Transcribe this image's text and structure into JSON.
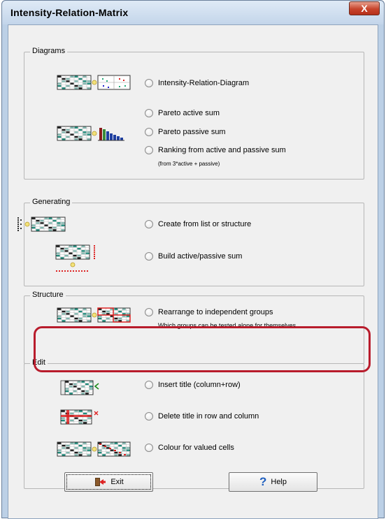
{
  "window": {
    "title": "Intensity-Relation-Matrix",
    "close_label": "X"
  },
  "groups": {
    "diagrams": {
      "label": "Diagrams",
      "options": {
        "intensity": "Intensity-Relation-Diagram",
        "pareto_active": "Pareto active sum",
        "pareto_passive": "Pareto passive sum",
        "ranking": "Ranking from active and passive sum",
        "ranking_note": "(from 3*active + passive)"
      }
    },
    "generating": {
      "label": "Generating",
      "options": {
        "create": "Create from list or structure",
        "build": "Build active/passive sum"
      }
    },
    "structure": {
      "label": "Structure",
      "options": {
        "rearrange": "Rearrange to independent groups",
        "rearrange_note": "Which groups can be tested alone for themselves"
      }
    },
    "edit": {
      "label": "Edit",
      "options": {
        "insert": "Insert title (column+row)",
        "delete": "Delete title in row and column",
        "colour": "Colour for valued cells"
      }
    }
  },
  "buttons": {
    "exit": "Exit",
    "help": "Help"
  },
  "colors": {
    "highlight": "#b81c2c",
    "matrix_fill": "#1e8a7a",
    "matrix_dark": "#1a1a1a"
  }
}
